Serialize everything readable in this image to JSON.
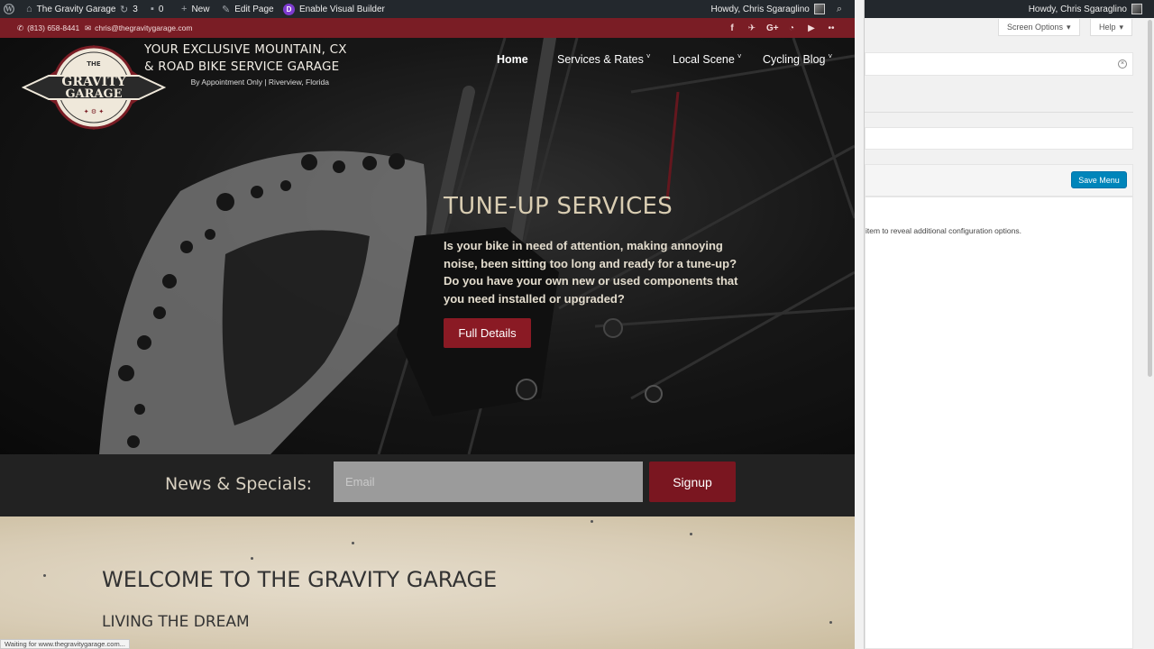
{
  "wp_admin_bar": {
    "site_name": "The Gravity Garage",
    "updates_count": "3",
    "comments_count": "0",
    "new_label": "New",
    "edit_page_label": "Edit Page",
    "visual_builder_label": "Enable Visual Builder",
    "howdy": "Howdy, Chris Sgaraglino"
  },
  "top_strip": {
    "phone": "(813) 658-8441",
    "email": "chris@thegravitygarage.com",
    "social_icons": [
      "facebook-icon",
      "twitter-icon",
      "google-plus-icon",
      "rss-icon",
      "youtube-icon",
      "flickr-icon"
    ]
  },
  "logo": {
    "top_word": "THE",
    "line1": "GRAVITY",
    "line2": "GARAGE"
  },
  "header": {
    "tagline_line1": "YOUR EXCLUSIVE MOUNTAIN, CX",
    "tagline_line2": "& ROAD BIKE SERVICE GARAGE",
    "tagline_line3": "By Appointment Only | Riverview, Florida"
  },
  "nav": {
    "items": [
      {
        "label": "Home",
        "active": true,
        "has_submenu": false
      },
      {
        "label": "Services & Rates",
        "active": false,
        "has_submenu": true
      },
      {
        "label": "Local Scene",
        "active": false,
        "has_submenu": true
      },
      {
        "label": "Cycling Blog",
        "active": false,
        "has_submenu": true
      }
    ]
  },
  "hero": {
    "title": "TUNE-UP SERVICES",
    "body": "Is your bike in need of attention, making annoying noise, been sitting too long and ready for a tune-up? Do you have your own new or used components that you need installed or upgraded?",
    "button_label": "Full Details"
  },
  "newsletter": {
    "label": "News & Specials:",
    "email_placeholder": "Email",
    "signup_label": "Signup"
  },
  "welcome": {
    "title": "WELCOME TO THE GRAVITY GARAGE",
    "subtitle": "LIVING THE DREAM"
  },
  "status_bar": {
    "text": "Waiting for www.thegravitygarage.com..."
  },
  "admin_panel": {
    "howdy": "Howdy, Chris Sgaraglino",
    "screen_options_label": "Screen Options",
    "help_label": "Help",
    "save_menu_label": "Save Menu",
    "hint_text": "item to reveal additional configuration options."
  },
  "colors": {
    "admin_bar": "#23282d",
    "brand_red": "#7a1d25",
    "button_red": "#8a1a24",
    "hero_title": "#d9cdb2",
    "wp_blue": "#0085ba"
  }
}
